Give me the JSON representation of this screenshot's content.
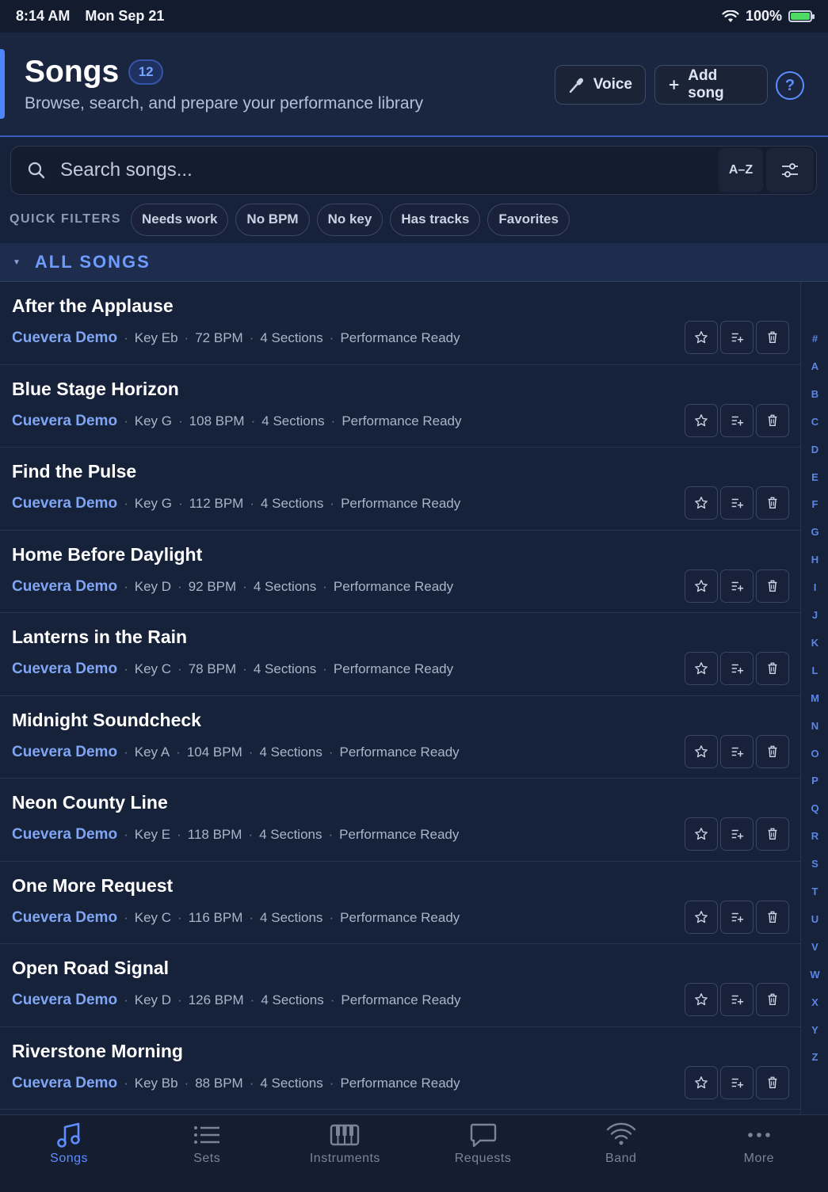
{
  "status": {
    "time": "8:14 AM",
    "date": "Mon Sep 21",
    "battery": "100%"
  },
  "header": {
    "title": "Songs",
    "count": "12",
    "subtitle": "Browse, search, and prepare your performance library",
    "voice_label": "Voice",
    "add_label": "Add song",
    "help_label": "?"
  },
  "search": {
    "placeholder": "Search songs...",
    "sort_label": "A–Z"
  },
  "quick_filters": {
    "label": "QUICK FILTERS",
    "chips": [
      "Needs work",
      "No BPM",
      "No key",
      "Has tracks",
      "Favorites"
    ]
  },
  "section": {
    "label": "ALL SONGS"
  },
  "songs": [
    {
      "title": "After the Applause",
      "artist": "Cuevera Demo",
      "key": "Key Eb",
      "bpm": "72 BPM",
      "sections": "4 Sections",
      "status": "Performance Ready"
    },
    {
      "title": "Blue Stage Horizon",
      "artist": "Cuevera Demo",
      "key": "Key G",
      "bpm": "108 BPM",
      "sections": "4 Sections",
      "status": "Performance Ready"
    },
    {
      "title": "Find the Pulse",
      "artist": "Cuevera Demo",
      "key": "Key G",
      "bpm": "112 BPM",
      "sections": "4 Sections",
      "status": "Performance Ready"
    },
    {
      "title": "Home Before Daylight",
      "artist": "Cuevera Demo",
      "key": "Key D",
      "bpm": "92 BPM",
      "sections": "4 Sections",
      "status": "Performance Ready"
    },
    {
      "title": "Lanterns in the Rain",
      "artist": "Cuevera Demo",
      "key": "Key C",
      "bpm": "78 BPM",
      "sections": "4 Sections",
      "status": "Performance Ready"
    },
    {
      "title": "Midnight Soundcheck",
      "artist": "Cuevera Demo",
      "key": "Key A",
      "bpm": "104 BPM",
      "sections": "4 Sections",
      "status": "Performance Ready"
    },
    {
      "title": "Neon County Line",
      "artist": "Cuevera Demo",
      "key": "Key E",
      "bpm": "118 BPM",
      "sections": "4 Sections",
      "status": "Performance Ready"
    },
    {
      "title": "One More Request",
      "artist": "Cuevera Demo",
      "key": "Key C",
      "bpm": "116 BPM",
      "sections": "4 Sections",
      "status": "Performance Ready"
    },
    {
      "title": "Open Road Signal",
      "artist": "Cuevera Demo",
      "key": "Key D",
      "bpm": "126 BPM",
      "sections": "4 Sections",
      "status": "Performance Ready"
    },
    {
      "title": "Riverstone Morning",
      "artist": "Cuevera Demo",
      "key": "Key Bb",
      "bpm": "88 BPM",
      "sections": "4 Sections",
      "status": "Performance Ready"
    }
  ],
  "alphabet": [
    "#",
    "A",
    "B",
    "C",
    "D",
    "E",
    "F",
    "G",
    "H",
    "I",
    "J",
    "K",
    "L",
    "M",
    "N",
    "O",
    "P",
    "Q",
    "R",
    "S",
    "T",
    "U",
    "V",
    "W",
    "X",
    "Y",
    "Z"
  ],
  "tabs": [
    {
      "label": "Songs",
      "icon": "music-note-icon",
      "active": true
    },
    {
      "label": "Sets",
      "icon": "list-icon",
      "active": false
    },
    {
      "label": "Instruments",
      "icon": "keyboard-icon",
      "active": false
    },
    {
      "label": "Requests",
      "icon": "chat-bubble-icon",
      "active": false
    },
    {
      "label": "Band",
      "icon": "wifi-icon",
      "active": false
    },
    {
      "label": "More",
      "icon": "more-dots-icon",
      "active": false
    }
  ],
  "colors": {
    "background": "#16213a",
    "accent": "#5d8dff",
    "artist": "#80a6f3"
  }
}
